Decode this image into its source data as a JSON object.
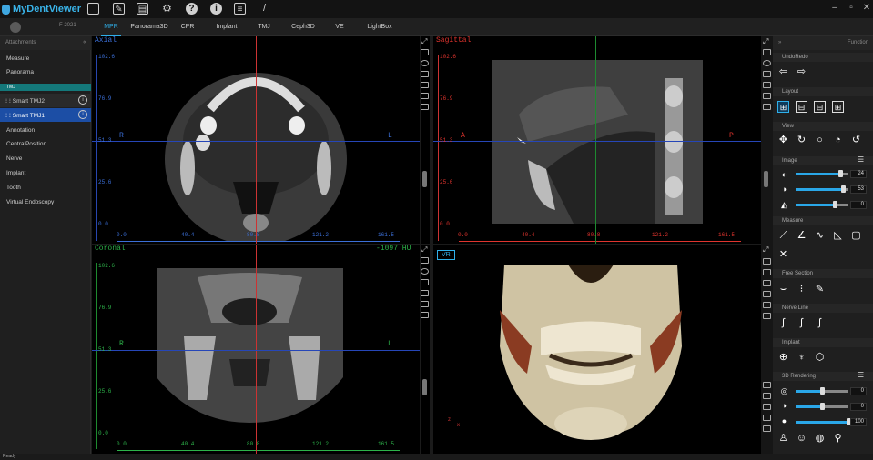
{
  "app": {
    "title": "MyDentViewer",
    "patient_info": "F 2021"
  },
  "toolbar": {
    "icons": [
      "folder-icon",
      "edit-icon",
      "print-icon",
      "settings-icon",
      "help-icon",
      "info-icon",
      "document-icon",
      "brush-icon"
    ]
  },
  "tabs": [
    "MPR",
    "Panorama3D",
    "CPR",
    "Implant",
    "TMJ",
    "Ceph3D",
    "VE",
    "LightBox"
  ],
  "active_tab": "MPR",
  "left": {
    "header": "Attachments",
    "items": [
      "Measure",
      "Panorama",
      "TMJ",
      "Smart TMJ2",
      "Smart TMJ1",
      "Annotation",
      "CentralPosition",
      "Nerve",
      "Implant",
      "Tooth",
      "Virtual Endoscopy"
    ]
  },
  "views": {
    "axial": {
      "title": "Axial",
      "left": "R",
      "right": "L",
      "yticks": [
        "102.6",
        "76.9",
        "51.3",
        "25.6",
        "0.0"
      ],
      "xticks": [
        "0.0",
        "40.4",
        "80.8",
        "121.2",
        "161.5"
      ]
    },
    "sagittal": {
      "title": "Sagittal",
      "left": "A",
      "right": "P",
      "yticks": [
        "102.6",
        "76.9",
        "51.3",
        "25.6",
        "0.0"
      ],
      "xticks": [
        "0.0",
        "40.4",
        "80.8",
        "121.2",
        "161.5"
      ]
    },
    "coronal": {
      "title": "Coronal",
      "left": "R",
      "right": "L",
      "hu": "-1097 HU",
      "yticks": [
        "102.6",
        "76.9",
        "51.3",
        "25.6",
        "0.0"
      ],
      "xticks": [
        "0.0",
        "40.4",
        "80.8",
        "121.2",
        "161.5"
      ]
    },
    "vr": {
      "title": "VR"
    }
  },
  "right": {
    "header": "Function",
    "sections": [
      "UndoRedo",
      "Layout",
      "View",
      "Image",
      "Measure",
      "Free Section",
      "Nerve Line",
      "Implant",
      "3D Rendering"
    ],
    "image_values": [
      "24",
      "53",
      "0"
    ],
    "image_fracs": [
      0.85,
      0.9,
      0.75
    ],
    "render_values": [
      "0",
      "0",
      "100"
    ],
    "render_fracs": [
      0.5,
      0.5,
      1.0
    ]
  },
  "status": "Ready",
  "colors": {
    "accent": "#2fb0ea",
    "axial": "#3b6fd8",
    "sagittal": "#e0342e",
    "coronal": "#2db44a",
    "selected": "#1c4ea5"
  }
}
